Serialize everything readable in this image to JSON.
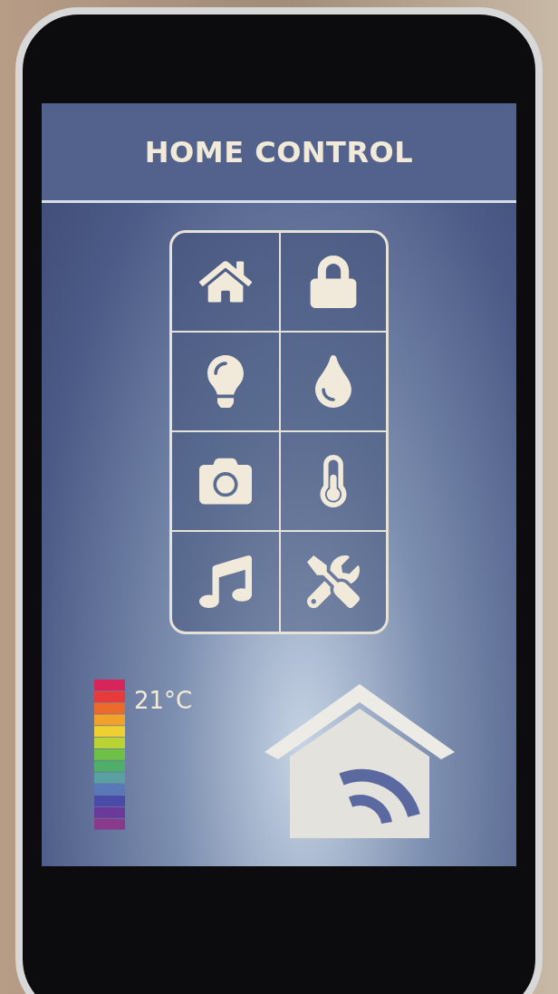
{
  "header": {
    "title": "HOME CONTROL"
  },
  "tiles": [
    {
      "kind": "house"
    },
    {
      "kind": "lock"
    },
    {
      "kind": "bulb"
    },
    {
      "kind": "drop"
    },
    {
      "kind": "camera"
    },
    {
      "kind": "thermometer"
    },
    {
      "kind": "music"
    },
    {
      "kind": "tools"
    }
  ],
  "temperature": {
    "reading": "21°C"
  }
}
